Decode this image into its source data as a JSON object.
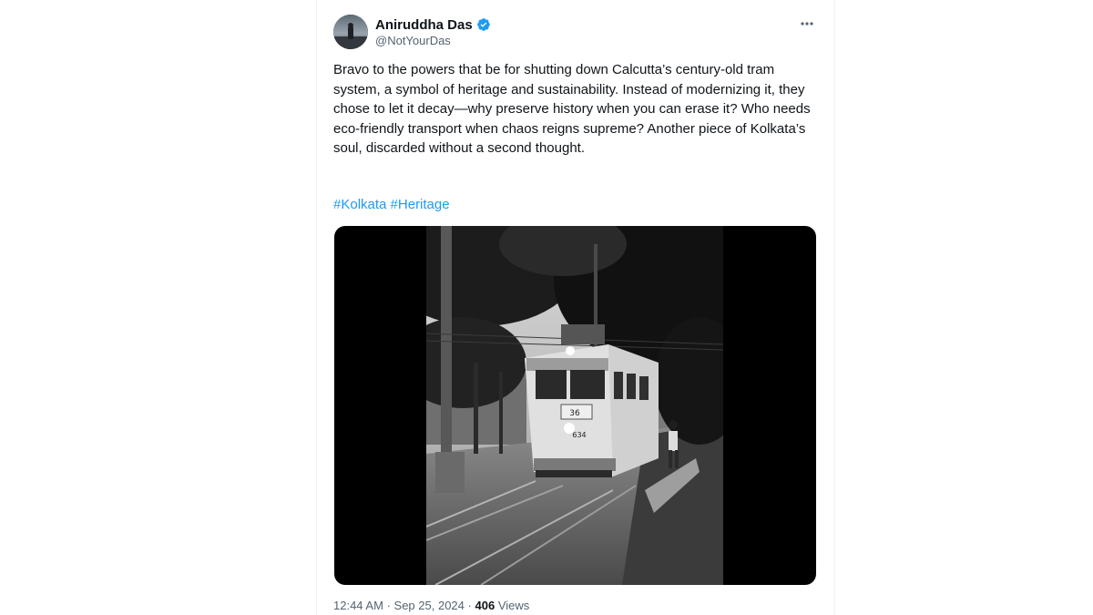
{
  "author": {
    "display_name": "Aniruddha Das",
    "handle": "@NotYourDas",
    "verified": true
  },
  "tweet": {
    "text": "Bravo to the powers that be for shutting down Calcutta’s century-old tram system, a symbol of heritage and sustainability. Instead of modernizing it, they chose to let it decay—why preserve history when you can erase it? Who needs eco-friendly transport when chaos reigns supreme? Another piece of Kolkata’s soul, discarded without a second thought.",
    "hashtags": [
      "#Kolkata",
      "#Heritage"
    ]
  },
  "media": {
    "type": "photo",
    "tram_route_sign": "36",
    "tram_number": "634"
  },
  "meta": {
    "time": "12:44 AM",
    "separator": "·",
    "date": "Sep 25, 2024",
    "views_count": "406",
    "views_label": "Views"
  },
  "icons": {
    "verified": "verified-badge-icon",
    "more": "more-options-icon"
  },
  "colors": {
    "accent": "#1d9bf0",
    "text": "#0f1419",
    "secondary_text": "#536471"
  }
}
